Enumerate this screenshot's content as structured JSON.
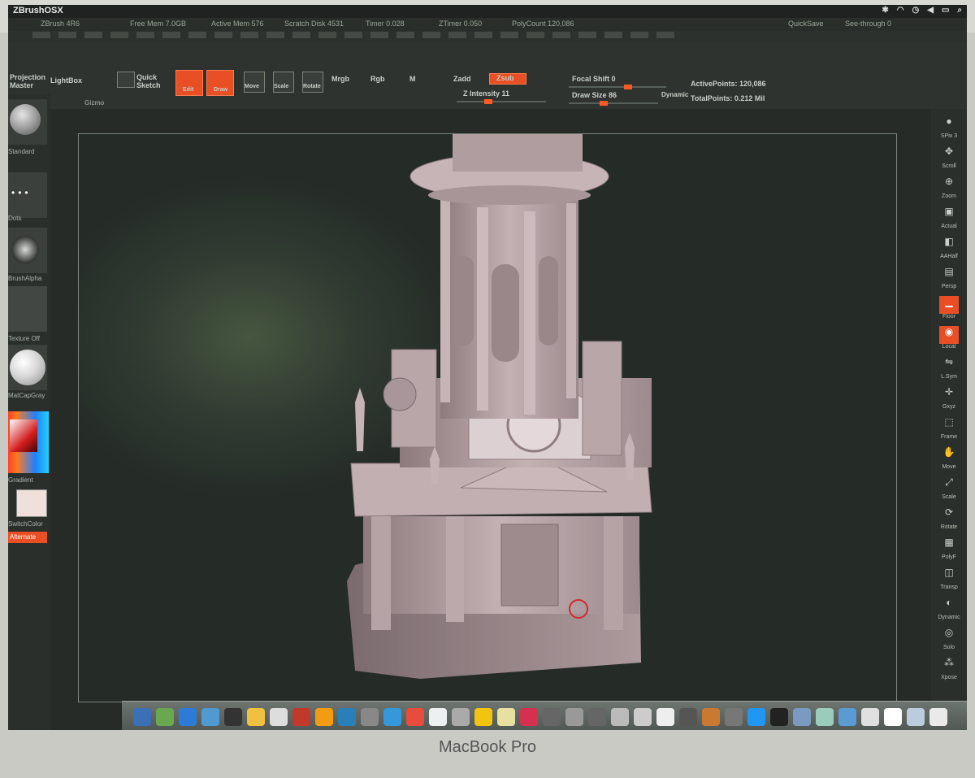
{
  "window": {
    "title": "ZBrushOSX"
  },
  "statusbar": {
    "items": [
      "ZBrush 4R6",
      "Free Mem 7.0GB",
      "Active Mem 576",
      "Scratch Disk 4531",
      "Timer 0.028",
      "ZTimer 0.050",
      "PolyCount 120,086"
    ],
    "right_label": "QuickSave",
    "seethrough": "See-through 0"
  },
  "toolbar": {
    "projection_master": "Projection Master",
    "lightbox": "LightBox",
    "quick_sketch": "Quick Sketch",
    "edit": "Edit",
    "draw": "Draw",
    "move": "Move",
    "scale": "Scale",
    "rotate": "Rotate",
    "mrgb": "Mrgb",
    "rgb": "Rgb",
    "m": "M",
    "zadd": "Zadd",
    "zsub": "Zsub",
    "z_intensity": "Z Intensity 11",
    "focal_shift": "Focal Shift 0",
    "draw_size": "Draw Size 86",
    "dynamic": "Dynamic",
    "active_points": "ActivePoints: 120,086",
    "total_points": "TotalPoints: 0.212 Mil",
    "gizmo": "Gizmo"
  },
  "left_tray": {
    "brush_label": "Standard",
    "stroke_label": "Dots",
    "alpha_label": "BrushAlpha",
    "texture_label": "Texture Off",
    "material_label": "MatCapGray",
    "gradient_label": "Gradient",
    "switch_color": "SwitchColor",
    "alternate": "Alternate"
  },
  "right_tray": {
    "items": [
      {
        "icon": "sphere-icon",
        "label": "SPix 3"
      },
      {
        "icon": "scroll-icon",
        "label": "Scroll"
      },
      {
        "icon": "zoom-icon",
        "label": "Zoom"
      },
      {
        "icon": "actual-icon",
        "label": "Actual"
      },
      {
        "icon": "aahalf-icon",
        "label": "AAHalf"
      },
      {
        "icon": "persp-icon",
        "label": "Persp"
      },
      {
        "icon": "floor-icon",
        "label": "Floor"
      },
      {
        "icon": "local-icon",
        "label": "Local"
      },
      {
        "icon": "lsym-icon",
        "label": "L.Sym"
      },
      {
        "icon": "xyz-icon",
        "label": "Gxyz"
      },
      {
        "icon": "frame-icon",
        "label": "Frame"
      },
      {
        "icon": "move-icon",
        "label": "Move"
      },
      {
        "icon": "scale-icon",
        "label": "Scale"
      },
      {
        "icon": "rotate-icon",
        "label": "Rotate"
      },
      {
        "icon": "polyf-icon",
        "label": "PolyF"
      },
      {
        "icon": "transp-icon",
        "label": "Transp"
      },
      {
        "icon": "ghost-icon",
        "label": "Dynamic"
      },
      {
        "icon": "solo-icon",
        "label": "Solo"
      },
      {
        "icon": "xpose-icon",
        "label": "Xpose"
      }
    ]
  },
  "device": {
    "brand": "MacBook Pro"
  },
  "colors": {
    "accent": "#e94f24",
    "background": "#262b27",
    "model": "#b9a6a9"
  }
}
